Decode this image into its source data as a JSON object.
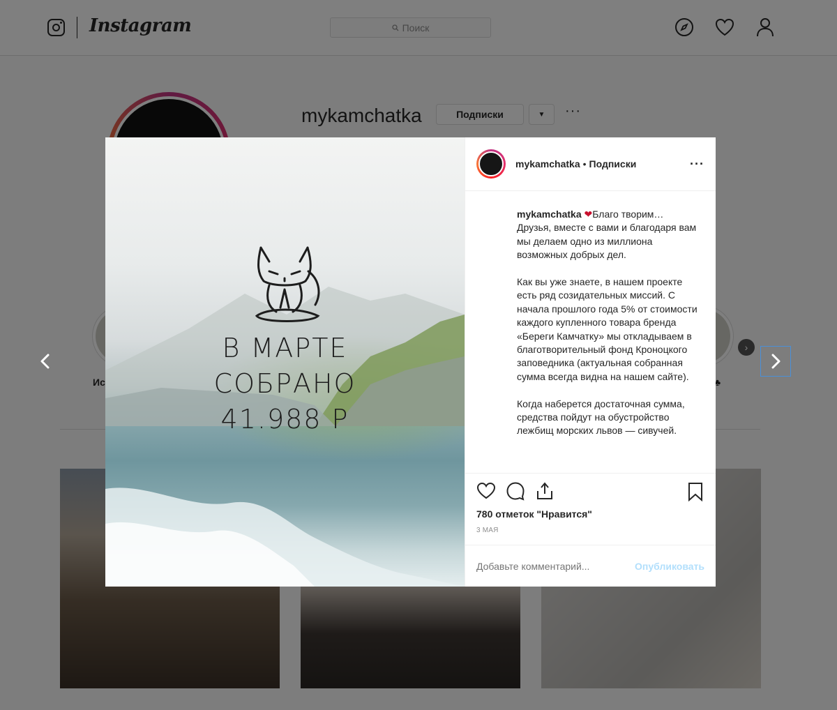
{
  "topbar": {
    "wordmark": "Instagram",
    "search_placeholder": "Поиск"
  },
  "profile": {
    "username": "mykamchatka",
    "follow_label": "Подписки",
    "dropdown_icon": "caret-down-icon",
    "more_label": "···"
  },
  "highlights": {
    "left_label": "Ис",
    "right_label": "♣"
  },
  "modal": {
    "prev_icon": "chevron-left-icon",
    "next_icon": "chevron-right-icon",
    "media": {
      "line1": "В МАРТЕ",
      "line2": "СОБРАНО",
      "line3": "41.988 Р"
    },
    "header": {
      "username": "mykamchatka",
      "separator": "•",
      "follow_label": "Подписки",
      "more_label": "···"
    },
    "caption": {
      "username": "mykamchatka",
      "heart": "❤",
      "intro": "Благо творим…\nДрузья, вместе с вами и благодаря вам мы делаем одно из миллиона возможных добрых дел.",
      "para2": "Как вы уже знаете, в нашем проекте есть ряд созидательных миссий. С начала прошлого года 5% от стоимости каждого купленного товара бренда «Береги Камчатку» мы откладываем в благотворительный фонд Кроноцкого заповедника (актуальная собранная сумма всегда видна на нашем сайте).",
      "para3": "Когда наберется достаточная сумма, средства пойдут на обустройство лежбищ морских львов — сивучей."
    },
    "likes": "780 отметок \"Нравится\"",
    "date": "3 мая",
    "comment_placeholder": "Добавьте комментарий...",
    "publish_label": "Опубликовать"
  },
  "colors": {
    "overlay": "#000000",
    "publish_disabled": "#b2dffc",
    "heart": "#c8102e"
  }
}
